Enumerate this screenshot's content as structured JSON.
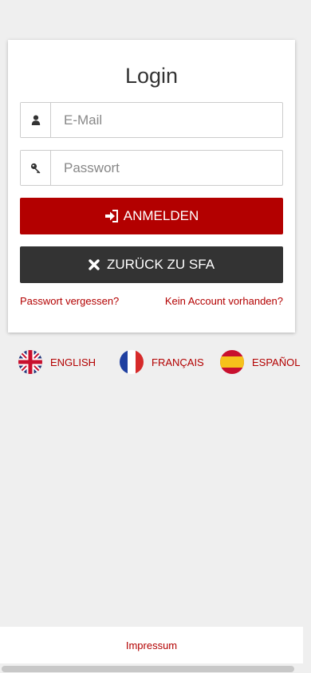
{
  "login": {
    "title": "Login",
    "email_placeholder": "E-Mail",
    "password_placeholder": "Passwort",
    "submit_label": "ANMELDEN",
    "back_label": "ZURÜCK ZU SFA",
    "forgot_link": "Passwort vergessen?",
    "no_account_link": "Kein Account vorhanden?"
  },
  "languages": [
    {
      "label": "ENGLISH",
      "flag": "uk-flag-icon"
    },
    {
      "label": "FRANÇAIS",
      "flag": "france-flag-icon"
    },
    {
      "label": "ESPAÑOL",
      "flag": "spain-flag-icon"
    }
  ],
  "footer": {
    "impressum": "Impressum"
  },
  "colors": {
    "accent": "#b30000",
    "dark_button": "#333333",
    "background": "#efefef"
  }
}
